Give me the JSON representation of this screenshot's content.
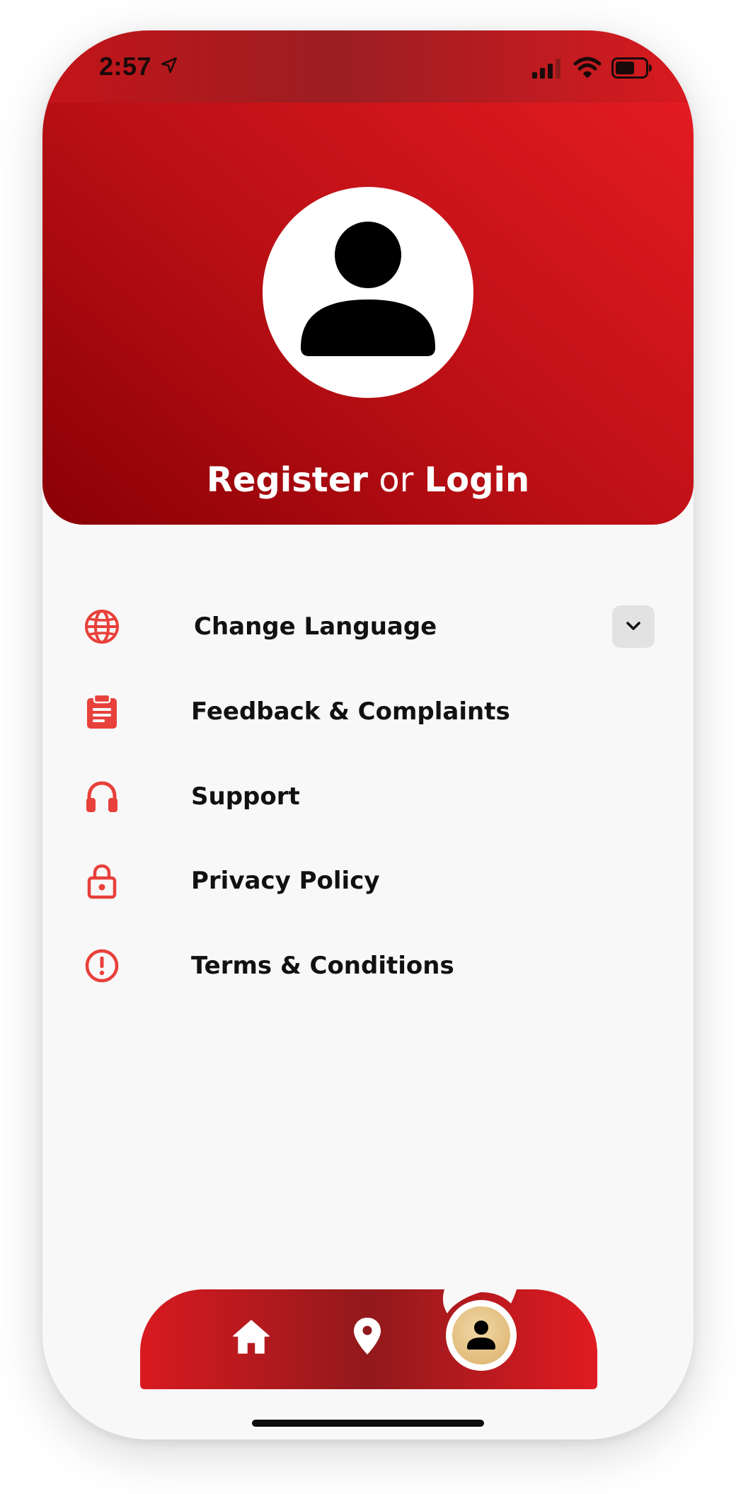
{
  "status_bar": {
    "time": "2:57",
    "icons": [
      "location-arrow-icon",
      "signal-icon",
      "wifi-icon",
      "battery-icon"
    ]
  },
  "header": {
    "register_label": "Register",
    "or_label": "or",
    "login_label": "Login",
    "avatar_icon": "person-icon"
  },
  "menu": {
    "items": [
      {
        "label": "Change Language",
        "icon": "globe-icon",
        "has_dropdown": true
      },
      {
        "label": "Feedback & Complaints",
        "icon": "clipboard-icon"
      },
      {
        "label": "Support",
        "icon": "headphones-icon"
      },
      {
        "label": "Privacy Policy",
        "icon": "lock-icon"
      },
      {
        "label": "Terms & Conditions",
        "icon": "alert-circle-icon"
      }
    ]
  },
  "bottom_nav": {
    "items": [
      {
        "icon": "home-icon",
        "active": false
      },
      {
        "icon": "location-pin-icon",
        "active": false
      },
      {
        "icon": "person-icon",
        "active": true
      }
    ]
  },
  "colors": {
    "brand_red": "#d81a20",
    "brand_dark_red": "#8a0006",
    "icon_red": "#e8403a",
    "active_tab_gold": "#e2bc7c",
    "background": "#f8f8f8"
  }
}
